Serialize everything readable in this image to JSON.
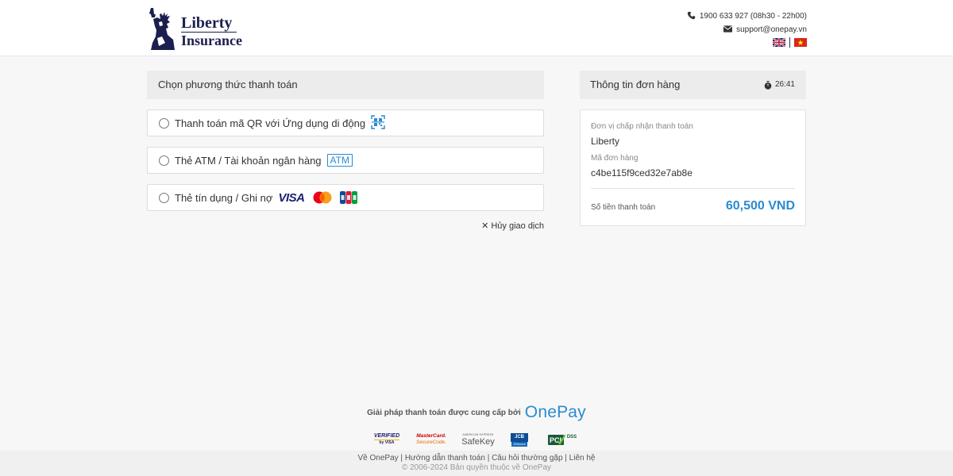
{
  "header": {
    "logo_line1": "Liberty",
    "logo_line2": "Insurance",
    "phone": "1900 633 927 (08h30 - 22h00)",
    "email": "support@onepay.vn",
    "languages": [
      "en-flag-icon",
      "vi-flag-icon"
    ]
  },
  "payment_methods": {
    "title": "Chọn phương thức thanh toán",
    "options": [
      {
        "label": "Thanh toán mã QR với Ứng dụng di động",
        "icon": "qr-code-icon"
      },
      {
        "label": "Thẻ ATM / Tài khoản ngân hàng",
        "badge": "ATM"
      },
      {
        "label": "Thẻ tín dụng / Ghi nợ",
        "brands": [
          "VISA",
          "mastercard-logo",
          "jcb-logo"
        ]
      }
    ],
    "cancel_label": "Hủy giao dịch"
  },
  "order_info": {
    "title": "Thông tin đơn hàng",
    "timer": "26:41",
    "merchant_label": "Đơn vị chấp nhận thanh toán",
    "merchant_value": "Liberty",
    "order_label": "Mã đơn hàng",
    "order_value": "c4be115f9ced32e7ab8e",
    "amount_label": "Số tiền thanh toán",
    "amount_value": "60,500 VND"
  },
  "footer": {
    "powered_text": "Giải pháp thanh toán được cung cấp bởi",
    "powered_brand": "OnePay",
    "badges": {
      "verified_1": "VERIFIED",
      "verified_2": "by VISA",
      "mastercard_1": "MasterCard.",
      "mastercard_2": "SecureCode.",
      "safekey_1": "AMERICAN EXPRESS",
      "safekey_2": "SafeKey",
      "jcb_1": "JCB",
      "jcb_2": "J/Secure",
      "pci": "DSS"
    },
    "links": [
      "Về OnePay",
      "Hướng dẫn thanh toán",
      "Câu hỏi thường gặp",
      "Liên hệ"
    ],
    "separator": " | ",
    "copyright": "© 2006-2024 Bản quyền thuộc về OnePay"
  },
  "colors": {
    "accent": "#2a8bd0",
    "brand_navy": "#1a1f4f",
    "background": "#f7f7f7"
  }
}
